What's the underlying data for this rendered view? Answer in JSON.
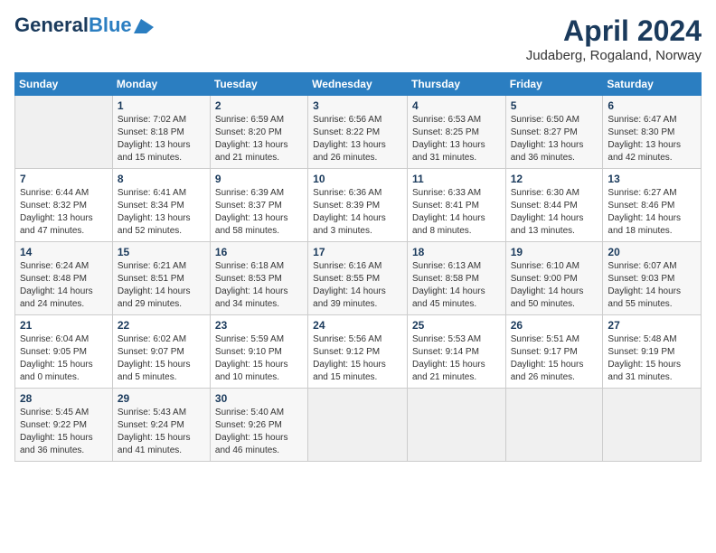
{
  "header": {
    "logo_general": "General",
    "logo_blue": "Blue",
    "title": "April 2024",
    "subtitle": "Judaberg, Rogaland, Norway"
  },
  "days_of_week": [
    "Sunday",
    "Monday",
    "Tuesday",
    "Wednesday",
    "Thursday",
    "Friday",
    "Saturday"
  ],
  "weeks": [
    [
      {
        "day": "",
        "detail": ""
      },
      {
        "day": "1",
        "detail": "Sunrise: 7:02 AM\nSunset: 8:18 PM\nDaylight: 13 hours\nand 15 minutes."
      },
      {
        "day": "2",
        "detail": "Sunrise: 6:59 AM\nSunset: 8:20 PM\nDaylight: 13 hours\nand 21 minutes."
      },
      {
        "day": "3",
        "detail": "Sunrise: 6:56 AM\nSunset: 8:22 PM\nDaylight: 13 hours\nand 26 minutes."
      },
      {
        "day": "4",
        "detail": "Sunrise: 6:53 AM\nSunset: 8:25 PM\nDaylight: 13 hours\nand 31 minutes."
      },
      {
        "day": "5",
        "detail": "Sunrise: 6:50 AM\nSunset: 8:27 PM\nDaylight: 13 hours\nand 36 minutes."
      },
      {
        "day": "6",
        "detail": "Sunrise: 6:47 AM\nSunset: 8:30 PM\nDaylight: 13 hours\nand 42 minutes."
      }
    ],
    [
      {
        "day": "7",
        "detail": "Sunrise: 6:44 AM\nSunset: 8:32 PM\nDaylight: 13 hours\nand 47 minutes."
      },
      {
        "day": "8",
        "detail": "Sunrise: 6:41 AM\nSunset: 8:34 PM\nDaylight: 13 hours\nand 52 minutes."
      },
      {
        "day": "9",
        "detail": "Sunrise: 6:39 AM\nSunset: 8:37 PM\nDaylight: 13 hours\nand 58 minutes."
      },
      {
        "day": "10",
        "detail": "Sunrise: 6:36 AM\nSunset: 8:39 PM\nDaylight: 14 hours\nand 3 minutes."
      },
      {
        "day": "11",
        "detail": "Sunrise: 6:33 AM\nSunset: 8:41 PM\nDaylight: 14 hours\nand 8 minutes."
      },
      {
        "day": "12",
        "detail": "Sunrise: 6:30 AM\nSunset: 8:44 PM\nDaylight: 14 hours\nand 13 minutes."
      },
      {
        "day": "13",
        "detail": "Sunrise: 6:27 AM\nSunset: 8:46 PM\nDaylight: 14 hours\nand 18 minutes."
      }
    ],
    [
      {
        "day": "14",
        "detail": "Sunrise: 6:24 AM\nSunset: 8:48 PM\nDaylight: 14 hours\nand 24 minutes."
      },
      {
        "day": "15",
        "detail": "Sunrise: 6:21 AM\nSunset: 8:51 PM\nDaylight: 14 hours\nand 29 minutes."
      },
      {
        "day": "16",
        "detail": "Sunrise: 6:18 AM\nSunset: 8:53 PM\nDaylight: 14 hours\nand 34 minutes."
      },
      {
        "day": "17",
        "detail": "Sunrise: 6:16 AM\nSunset: 8:55 PM\nDaylight: 14 hours\nand 39 minutes."
      },
      {
        "day": "18",
        "detail": "Sunrise: 6:13 AM\nSunset: 8:58 PM\nDaylight: 14 hours\nand 45 minutes."
      },
      {
        "day": "19",
        "detail": "Sunrise: 6:10 AM\nSunset: 9:00 PM\nDaylight: 14 hours\nand 50 minutes."
      },
      {
        "day": "20",
        "detail": "Sunrise: 6:07 AM\nSunset: 9:03 PM\nDaylight: 14 hours\nand 55 minutes."
      }
    ],
    [
      {
        "day": "21",
        "detail": "Sunrise: 6:04 AM\nSunset: 9:05 PM\nDaylight: 15 hours\nand 0 minutes."
      },
      {
        "day": "22",
        "detail": "Sunrise: 6:02 AM\nSunset: 9:07 PM\nDaylight: 15 hours\nand 5 minutes."
      },
      {
        "day": "23",
        "detail": "Sunrise: 5:59 AM\nSunset: 9:10 PM\nDaylight: 15 hours\nand 10 minutes."
      },
      {
        "day": "24",
        "detail": "Sunrise: 5:56 AM\nSunset: 9:12 PM\nDaylight: 15 hours\nand 15 minutes."
      },
      {
        "day": "25",
        "detail": "Sunrise: 5:53 AM\nSunset: 9:14 PM\nDaylight: 15 hours\nand 21 minutes."
      },
      {
        "day": "26",
        "detail": "Sunrise: 5:51 AM\nSunset: 9:17 PM\nDaylight: 15 hours\nand 26 minutes."
      },
      {
        "day": "27",
        "detail": "Sunrise: 5:48 AM\nSunset: 9:19 PM\nDaylight: 15 hours\nand 31 minutes."
      }
    ],
    [
      {
        "day": "28",
        "detail": "Sunrise: 5:45 AM\nSunset: 9:22 PM\nDaylight: 15 hours\nand 36 minutes."
      },
      {
        "day": "29",
        "detail": "Sunrise: 5:43 AM\nSunset: 9:24 PM\nDaylight: 15 hours\nand 41 minutes."
      },
      {
        "day": "30",
        "detail": "Sunrise: 5:40 AM\nSunset: 9:26 PM\nDaylight: 15 hours\nand 46 minutes."
      },
      {
        "day": "",
        "detail": ""
      },
      {
        "day": "",
        "detail": ""
      },
      {
        "day": "",
        "detail": ""
      },
      {
        "day": "",
        "detail": ""
      }
    ]
  ]
}
